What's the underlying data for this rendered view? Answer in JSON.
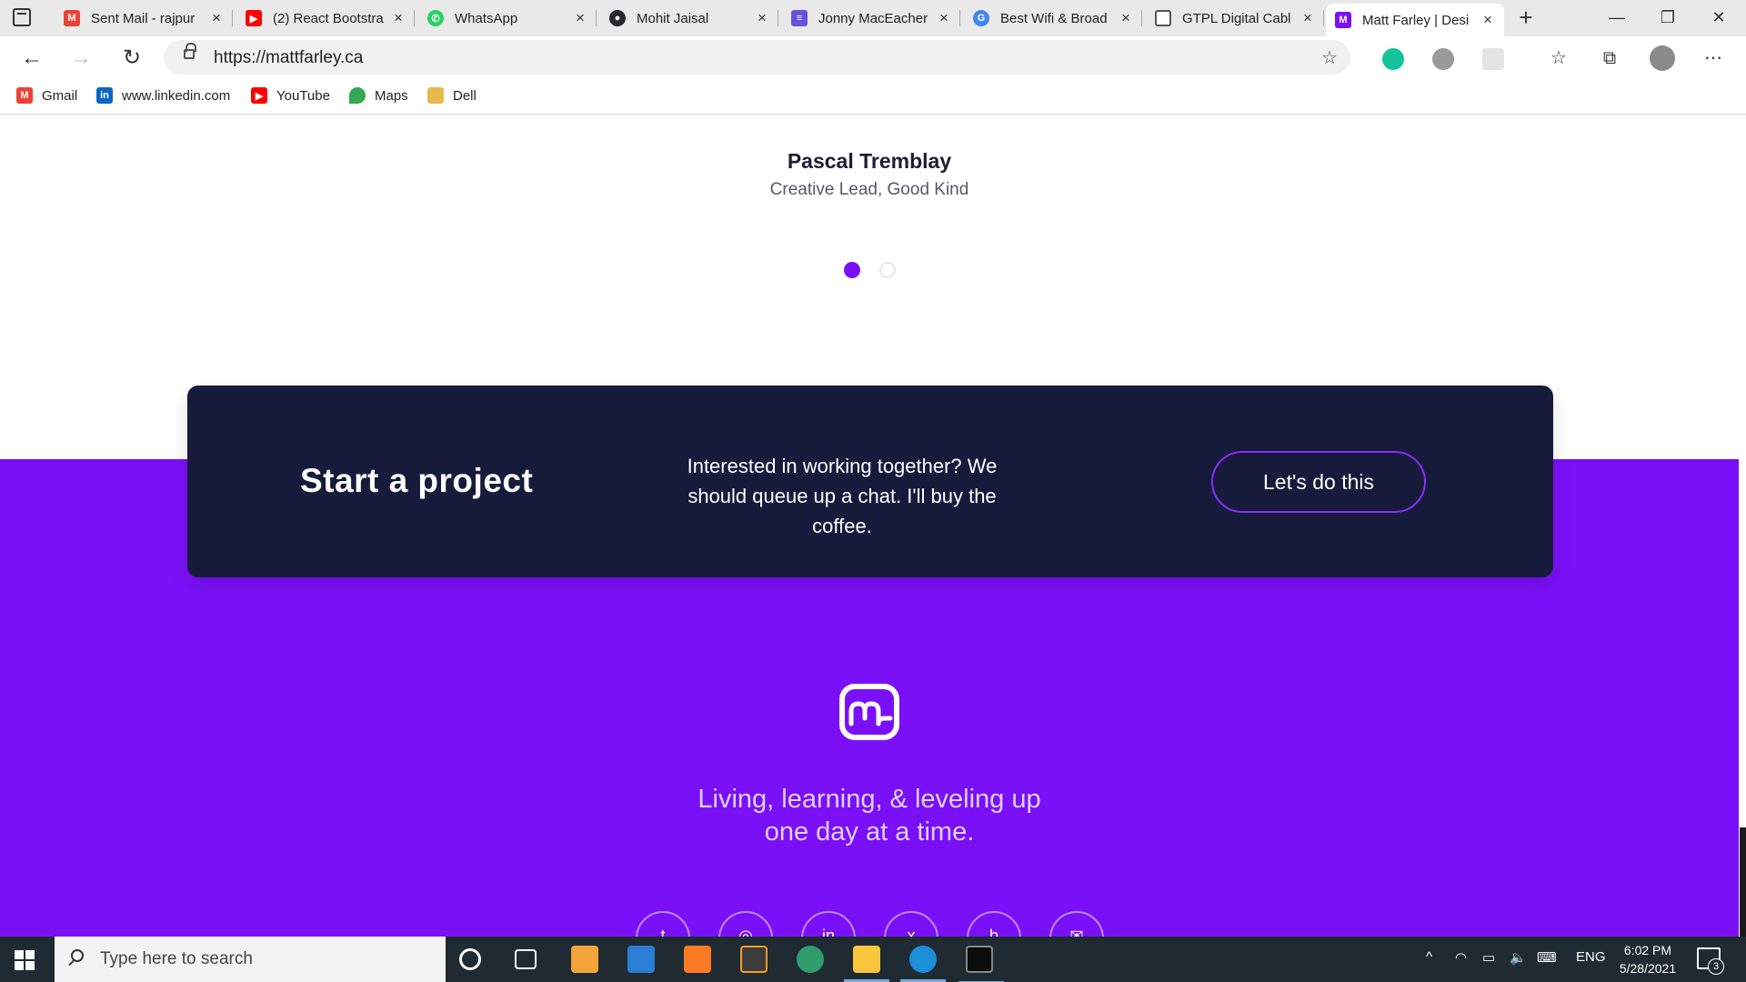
{
  "browser": {
    "tabs": [
      {
        "title": "Sent Mail - rajpur",
        "icon": "gmail-icon",
        "color": "#ea4335",
        "glyph": "M"
      },
      {
        "title": "(2) React Bootstra",
        "icon": "youtube-icon",
        "color": "#ff0000",
        "glyph": "▶"
      },
      {
        "title": "WhatsApp",
        "icon": "whatsapp-icon",
        "color": "#25d366",
        "glyph": "✆"
      },
      {
        "title": "Mohit Jaisal",
        "icon": "github-icon",
        "color": "#24292e",
        "glyph": "●"
      },
      {
        "title": "Jonny MacEacher",
        "icon": "doc-icon",
        "color": "#6354d8",
        "glyph": "≡"
      },
      {
        "title": "Best Wifi & Broad",
        "icon": "google-icon",
        "color": "#4285f4",
        "glyph": "G"
      },
      {
        "title": "GTPL Digital Cabl",
        "icon": "page-icon",
        "color": "#777777",
        "glyph": "▯"
      },
      {
        "title": "Matt Farley | Desi",
        "icon": "mattfarley-icon",
        "color": "#7a10f7",
        "glyph": "M"
      }
    ],
    "new_tab": "+",
    "window": {
      "minimize": "—",
      "restore": "❐",
      "close": "✕"
    },
    "url": "https://mattfarley.ca",
    "bookmarks": [
      {
        "label": "Gmail",
        "icon": "gmail-icon",
        "color": "#ea4335",
        "glyph": "M"
      },
      {
        "label": "www.linkedin.com",
        "icon": "linkedin-icon",
        "color": "#0a66c2",
        "glyph": "in"
      },
      {
        "label": "YouTube",
        "icon": "youtube-icon",
        "color": "#ff0000",
        "glyph": "▶"
      },
      {
        "label": "Maps",
        "icon": "maps-icon",
        "color": "#34a853",
        "glyph": "◆"
      },
      {
        "label": "Dell",
        "icon": "folder-icon",
        "color": "#e8b84a",
        "glyph": ""
      }
    ]
  },
  "page": {
    "testimonial": {
      "name": "Pascal Tremblay",
      "role": "Creative Lead, Good Kind"
    },
    "cta": {
      "title": "Start a project",
      "text": "Interested in working together? We should queue up a chat. I'll buy the coffee.",
      "button": "Let's do this"
    },
    "tagline_line1": "Living, learning, & leveling up",
    "tagline_line2": "one day at a time.",
    "socials": [
      "twitter-icon",
      "dribbble-icon",
      "linkedin-icon",
      "xing-icon",
      "behance-icon",
      "mail-icon"
    ],
    "colors": {
      "brand_purple": "#7a10f7",
      "navy": "#161b3b"
    }
  },
  "taskbar": {
    "search_placeholder": "Type here to search",
    "language": "ENG",
    "time": "6:02 PM",
    "date": "5/28/2021",
    "notifications": "3"
  }
}
